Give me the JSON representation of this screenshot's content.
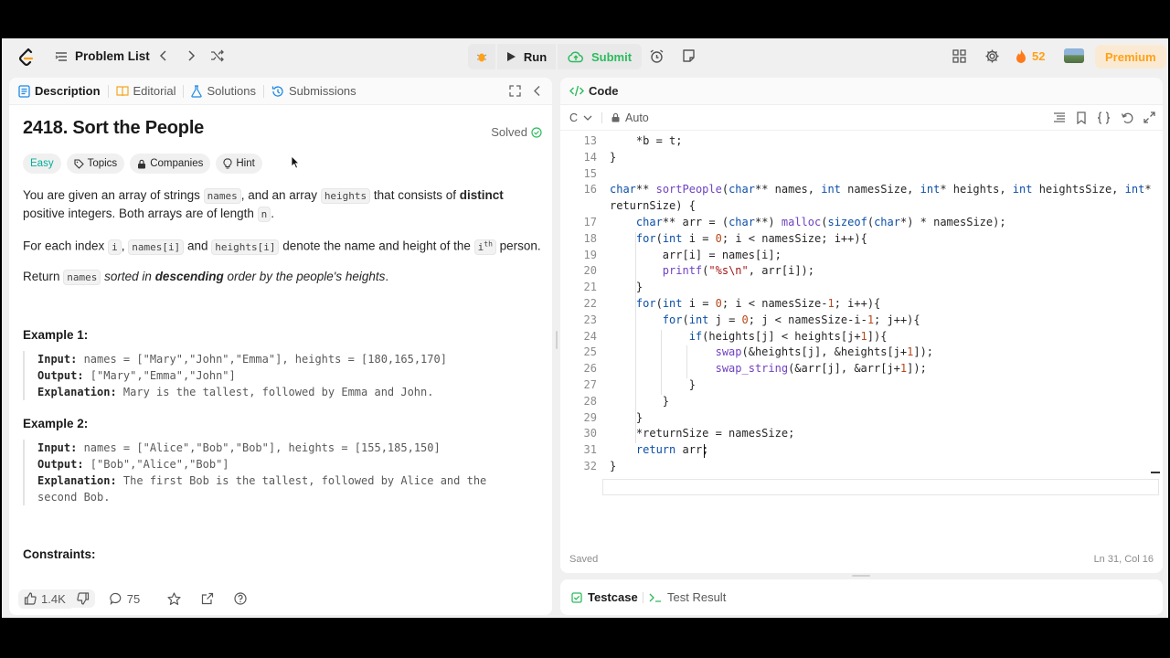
{
  "topbar": {
    "problem_list": "Problem List",
    "run": "Run",
    "submit": "Submit",
    "streak": "52",
    "premium": "Premium",
    "accent": "#ffa116",
    "submit_color": "#2cbb5d"
  },
  "left_tabs": [
    {
      "label": "Description",
      "icon": "description-icon"
    },
    {
      "label": "Editorial",
      "icon": "editorial-icon"
    },
    {
      "label": "Solutions",
      "icon": "solutions-icon"
    },
    {
      "label": "Submissions",
      "icon": "submissions-icon"
    }
  ],
  "problem": {
    "title": "2418. Sort the People",
    "solved": "Solved",
    "difficulty": "Easy",
    "chips": [
      "Topics",
      "Companies",
      "Hint"
    ],
    "p1": {
      "a": "You are given an array of strings ",
      "names": "names",
      "b": ", and an array ",
      "heights": "heights",
      "c": " that consists of ",
      "distinct": "distinct",
      "d": " positive integers. Both arrays are of length ",
      "n": "n",
      "e": "."
    },
    "p2": {
      "a": "For each index ",
      "i": "i",
      "b": ", ",
      "names_i": "names[i]",
      "c": " and ",
      "heights_i": "heights[i]",
      "d": " denote the name and height of the ",
      "ith": "i",
      "sup": "th",
      "e": " person."
    },
    "p3": {
      "a": "Return ",
      "names": "names",
      "b": " sorted in ",
      "descending": "descending",
      "c": " order by the people's heights",
      "d": "."
    },
    "examples": [
      {
        "heading": "Example 1:",
        "input_label": "Input:",
        "input": " names = [\"Mary\",\"John\",\"Emma\"], heights = [180,165,170]",
        "output_label": "Output:",
        "output": " [\"Mary\",\"Emma\",\"John\"]",
        "expl_label": "Explanation:",
        "expl": " Mary is the tallest, followed by Emma and John."
      },
      {
        "heading": "Example 2:",
        "input_label": "Input:",
        "input": " names = [\"Alice\",\"Bob\",\"Bob\"], heights = [155,185,150]",
        "output_label": "Output:",
        "output": " [\"Bob\",\"Alice\",\"Bob\"]",
        "expl_label": "Explanation:",
        "expl": " The first Bob is the tallest, followed by Alice and the",
        "expl2": "second Bob."
      }
    ],
    "constraints": "Constraints:"
  },
  "left_footer": {
    "likes": "1.4K",
    "comments": "75"
  },
  "code": {
    "header": "Code",
    "language": "C",
    "mode": "Auto",
    "saved": "Saved",
    "position": "Ln 31, Col 16",
    "lines": [
      {
        "n": "13",
        "t": "    *b = t;"
      },
      {
        "n": "14",
        "t": "}"
      },
      {
        "n": "15",
        "t": ""
      },
      {
        "n": "16",
        "t": "char** sortPeople(char** names, int namesSize, int* heights, int heightsSize, int*"
      },
      {
        "n": "",
        "t": "returnSize) {"
      },
      {
        "n": "17",
        "t": "    char** arr = (char**) malloc(sizeof(char*) * namesSize);"
      },
      {
        "n": "18",
        "t": "    for(int i = 0; i < namesSize; i++){"
      },
      {
        "n": "19",
        "t": "        arr[i] = names[i];"
      },
      {
        "n": "20",
        "t": "        printf(\"%s\\n\", arr[i]);"
      },
      {
        "n": "21",
        "t": "    }"
      },
      {
        "n": "22",
        "t": "    for(int i = 0; i < namesSize-1; i++){"
      },
      {
        "n": "23",
        "t": "        for(int j = 0; j < namesSize-i-1; j++){"
      },
      {
        "n": "24",
        "t": "            if(heights[j] < heights[j+1]){"
      },
      {
        "n": "25",
        "t": "                swap(&heights[j], &heights[j+1]);"
      },
      {
        "n": "26",
        "t": "                swap_string(&arr[j], &arr[j+1]);"
      },
      {
        "n": "27",
        "t": "            }"
      },
      {
        "n": "28",
        "t": "        }"
      },
      {
        "n": "29",
        "t": "    }"
      },
      {
        "n": "30",
        "t": "    *returnSize = namesSize;"
      },
      {
        "n": "31",
        "t": "    return arr;"
      },
      {
        "n": "32",
        "t": "}"
      }
    ]
  },
  "bottom_tabs": {
    "testcase": "Testcase",
    "result": "Test Result"
  }
}
